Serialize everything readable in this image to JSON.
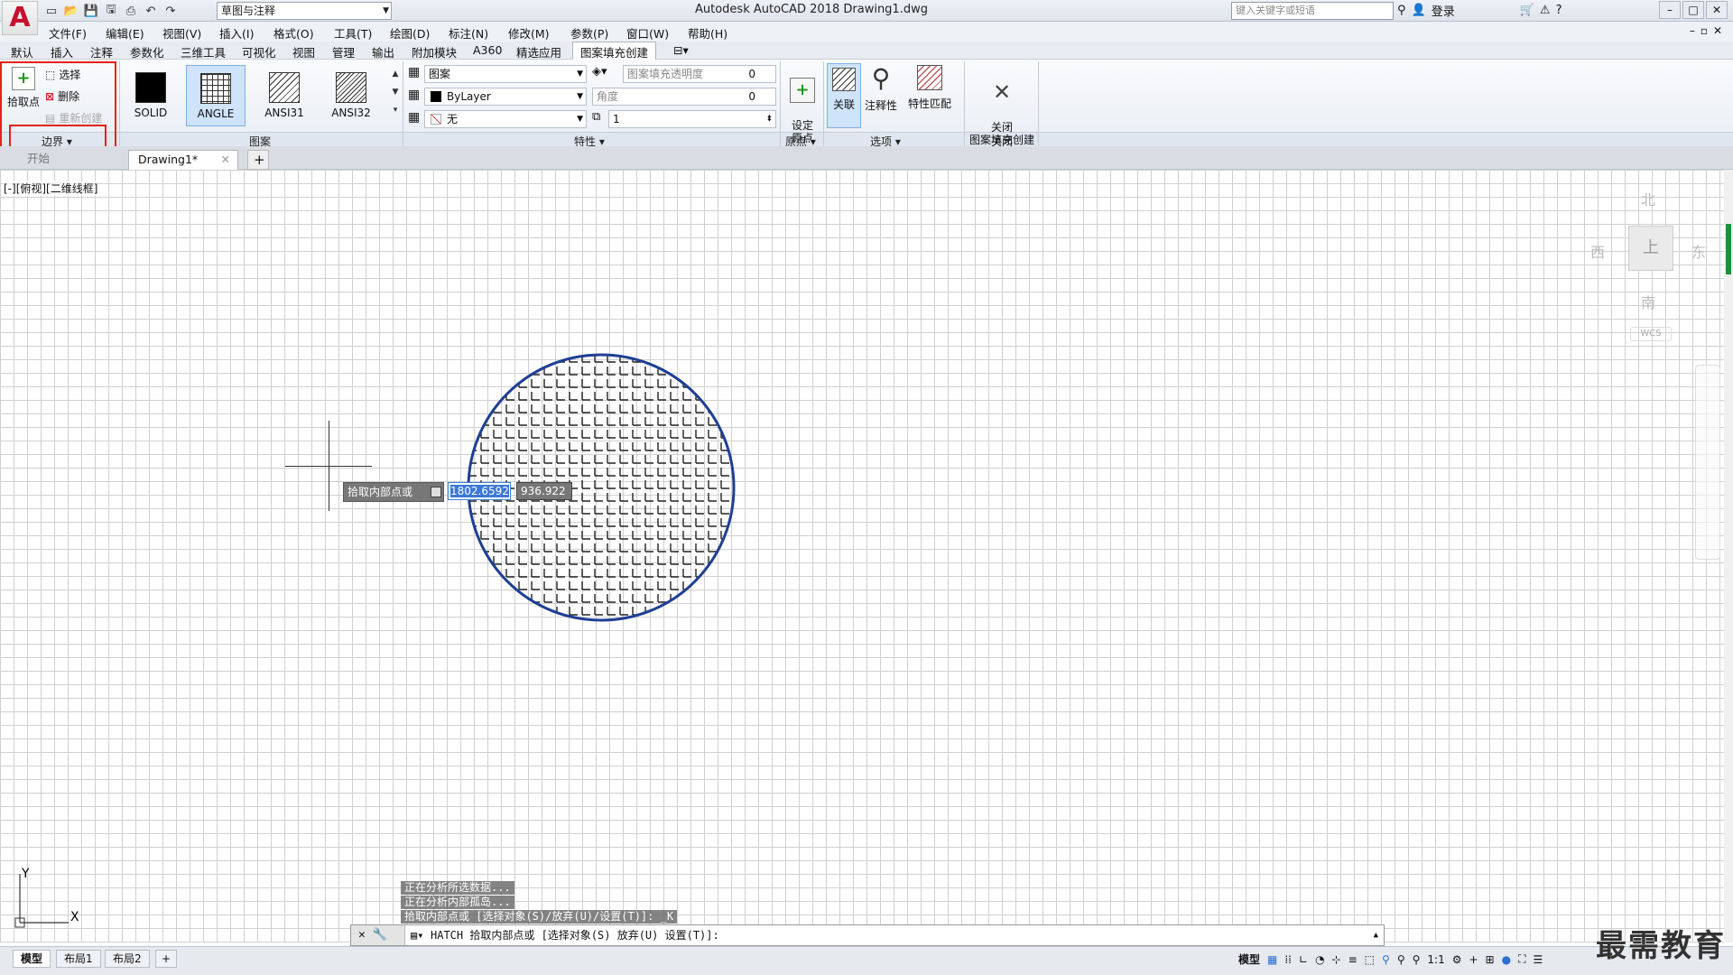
{
  "titlebar": {
    "workspace": "草图与注释",
    "title": "Autodesk AutoCAD 2018    Drawing1.dwg",
    "search_placeholder": "键入关键字或短语",
    "login": "登录"
  },
  "menu": [
    "文件(F)",
    "编辑(E)",
    "视图(V)",
    "插入(I)",
    "格式(O)",
    "工具(T)",
    "绘图(D)",
    "标注(N)",
    "修改(M)",
    "参数(P)",
    "窗口(W)",
    "帮助(H)"
  ],
  "ribbon_tabs": [
    "默认",
    "插入",
    "注释",
    "参数化",
    "三维工具",
    "可视化",
    "视图",
    "管理",
    "输出",
    "附加模块",
    "A360",
    "精选应用",
    "图案填充创建"
  ],
  "ribbon": {
    "boundary": {
      "pick_point": "拾取点",
      "select": "选择",
      "remove": "删除",
      "recreate": "重新创建",
      "panel_label": "边界 ▾"
    },
    "patterns": {
      "items": [
        "SOLID",
        "ANGLE",
        "ANSI31",
        "ANSI32"
      ],
      "active": "ANGLE",
      "panel_label": "图案"
    },
    "properties": {
      "type": "图案",
      "transparency_label": "图案填充透明度",
      "transparency": "0",
      "color": "ByLayer",
      "angle_label": "角度",
      "angle": "0",
      "background": "无",
      "scale": "1",
      "panel_label": "特性 ▾"
    },
    "origin": {
      "set_origin": "设定\n原点",
      "panel_label": "原点 ▾"
    },
    "options": {
      "associative": "关联",
      "annotative": "注释性",
      "match": "特性匹配",
      "panel_label": "选项 ▾"
    },
    "close": {
      "label": "关闭\n图案填充创建",
      "panel_label": "关闭"
    }
  },
  "doc_tabs": {
    "start": "开始",
    "drawing": "Drawing1*"
  },
  "viewport": {
    "label": "[-][俯视][二维线框]",
    "north": "北",
    "south": "南",
    "east": "东",
    "west": "西",
    "cube_face": "上",
    "wcs": "WCS"
  },
  "dynamic_input": {
    "prompt": "拾取内部点或",
    "x": "1802.6592",
    "y": "936.922"
  },
  "command_history": [
    "正在分析所选数据...",
    "正在分析内部孤岛...",
    "拾取内部点或 [选择对象(S)/放弃(U)/设置(T)]: _K"
  ],
  "command_line": "HATCH 拾取内部点或 [选择对象(S) 放弃(U) 设置(T)]:",
  "layout_tabs": [
    "模型",
    "布局1",
    "布局2"
  ],
  "status": {
    "model": "模型",
    "scale": "1:1"
  },
  "watermark": "最需教育",
  "colors": {
    "accent_red": "#e2231a",
    "hatch_blue": "#1f3f94",
    "ribbon_active": "#cfe3fa"
  }
}
